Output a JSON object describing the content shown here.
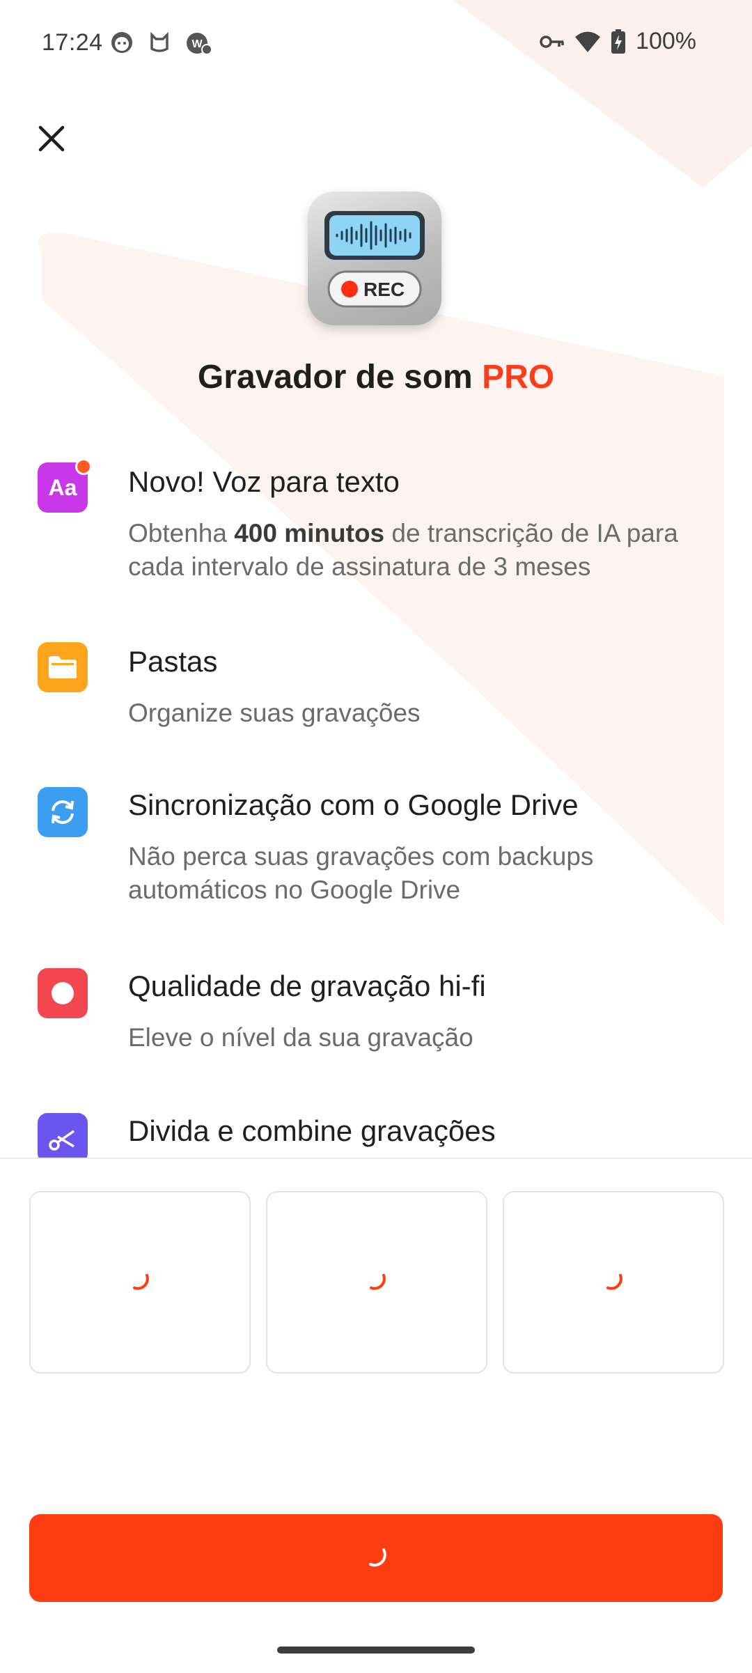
{
  "status_bar": {
    "time": "17:24",
    "battery": "100%",
    "left_icons": [
      "face-notification-icon",
      "cat-notification-icon",
      "vpn-badge-icon"
    ],
    "right_icons": [
      "key-icon",
      "wifi-icon",
      "battery-charging-icon"
    ]
  },
  "header": {
    "close_icon": "close-icon",
    "app_icon": "recorder-app-icon",
    "app_icon_label": "REC",
    "title_main": "Gravador de som ",
    "title_pro": "PRO"
  },
  "features": [
    {
      "icon": "text-aa-icon",
      "icon_color": "#c837e8",
      "title": "Novo! Voz para texto",
      "desc_pre": "Obtenha ",
      "desc_bold": "400 minutos",
      "desc_post": " de transcrição de IA para cada intervalo de assinatura de 3 meses"
    },
    {
      "icon": "folder-icon",
      "icon_color": "#ffa41b",
      "title": "Pastas",
      "desc": "Organize suas gravações"
    },
    {
      "icon": "sync-icon",
      "icon_color": "#3c9ef0",
      "title": "Sincronização com o Google Drive",
      "desc": "Não perca suas gravações com backups automáticos no Google Drive"
    },
    {
      "icon": "record-icon",
      "icon_color": "#f2474f",
      "title": "Qualidade de gravação hi-fi",
      "desc": "Eleve o nível da sua gravação"
    },
    {
      "icon": "scissors-icon",
      "icon_color": "#6d55f0",
      "title": "Divida e combine gravações"
    }
  ],
  "plans": [
    {
      "state": "loading"
    },
    {
      "state": "loading"
    },
    {
      "state": "loading"
    }
  ],
  "cta": {
    "state": "loading"
  },
  "colors": {
    "accent": "#ff3d13",
    "pro_text": "#ff3d18"
  }
}
